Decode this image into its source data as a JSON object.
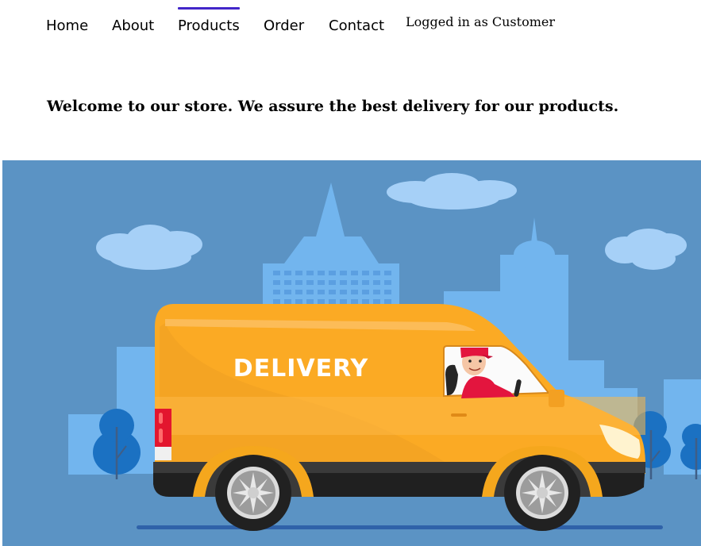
{
  "nav": {
    "items": [
      {
        "label": "Home",
        "active": false
      },
      {
        "label": "About",
        "active": false
      },
      {
        "label": "Products",
        "active": true
      },
      {
        "label": "Order",
        "active": false
      },
      {
        "label": "Contact",
        "active": false
      }
    ],
    "active_color": "#4226c9"
  },
  "user": {
    "status": "Logged in as Customer"
  },
  "main": {
    "welcome": "Welcome to our store. We assure the best delivery for our products."
  },
  "hero": {
    "van_label": "DELIVERY",
    "colors": {
      "sky": "#5b93c4",
      "building": "#72b5ee",
      "cloud": "#a6d0f7",
      "tree": "#1b71c2",
      "van": "#fbaa24",
      "road": "#2f62a9"
    }
  }
}
